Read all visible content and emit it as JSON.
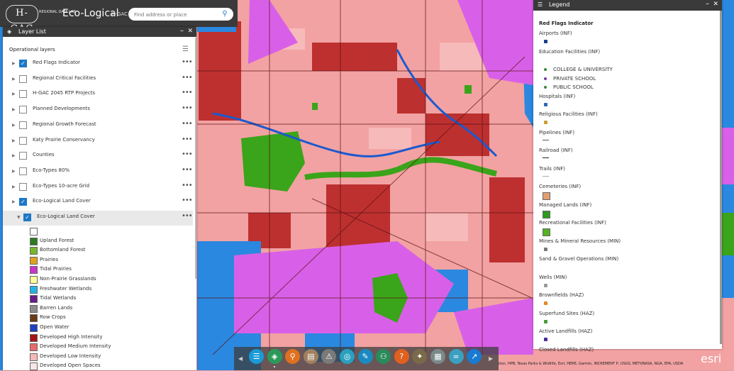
{
  "header": {
    "logo_text": "H-GAC",
    "logo_sub": "REGIONAL DATA LAB",
    "title": "Eco-Logical",
    "subtitle": "H-GAC",
    "search_placeholder": "Find address or place",
    "search_icon": "search-icon"
  },
  "layer_list": {
    "title": "Layer List",
    "section_label": "Operational layers",
    "layers": [
      {
        "label": "Red Flags Indicator",
        "checked": true
      },
      {
        "label": "Regional Critical Facilities",
        "checked": false
      },
      {
        "label": "H-GAC 2045 RTP Projects",
        "checked": false
      },
      {
        "label": "Planned Developments",
        "checked": false
      },
      {
        "label": "Regional Growth Forecast",
        "checked": false
      },
      {
        "label": "Katy Prairie Conservancy",
        "checked": false
      },
      {
        "label": "Counties",
        "checked": false
      },
      {
        "label": "Eco-Types 80%",
        "checked": false
      },
      {
        "label": "Eco-Types 10-acre Grid",
        "checked": false
      },
      {
        "label": "Eco-Logical Land Cover",
        "checked": true
      }
    ],
    "sublayer": {
      "label": "Eco-Logical Land Cover",
      "checked": true
    },
    "land_cover": [
      {
        "label": "",
        "color": "#ffffff"
      },
      {
        "label": "Upland Forest",
        "color": "#2d7a1f"
      },
      {
        "label": "Bottomland Forest",
        "color": "#76b82a"
      },
      {
        "label": "Prairies",
        "color": "#e0a020"
      },
      {
        "label": "Tidal Prairies",
        "color": "#cc33cc"
      },
      {
        "label": "Non-Prairie Grasslands",
        "color": "#ffff99"
      },
      {
        "label": "Freshwater Wetlands",
        "color": "#22b5e8"
      },
      {
        "label": "Tidal Wetlands",
        "color": "#6a1a8a"
      },
      {
        "label": "Barren Lands",
        "color": "#8c8c8c"
      },
      {
        "label": "Row Crops",
        "color": "#6b3a14"
      },
      {
        "label": "Open Water",
        "color": "#1f3fc4"
      },
      {
        "label": "Developed High Intensity",
        "color": "#a81414"
      },
      {
        "label": "Developed Medium Intensity",
        "color": "#e86a6a"
      },
      {
        "label": "Developed Low Intensity",
        "color": "#f6b8b8"
      },
      {
        "label": "Developed Open Spaces",
        "color": "#f6e6e6"
      }
    ],
    "more_glyph": "•••"
  },
  "legend": {
    "title": "Legend",
    "layer_title": "Red Flags Indicator",
    "items": [
      {
        "label": "Airports (INF)",
        "symbol": "airport-symbol",
        "color": "#1c3e8a"
      },
      {
        "label": "Education Facilities (INF)",
        "symbol": "none",
        "color": ""
      },
      {
        "label": "COLLEGE & UNIVERSITY",
        "symbol": "dot",
        "color": "#3a8a3a"
      },
      {
        "label": "PRIVATE SCHOOL",
        "symbol": "dot",
        "color": "#7a3a9a"
      },
      {
        "label": "PUBLIC SCHOOL",
        "symbol": "dot",
        "color": "#3a8a3a"
      },
      {
        "label": "Hospitals (INF)",
        "symbol": "hospital-symbol",
        "color": "#2c6ab0"
      },
      {
        "label": "Religious Facilities (INF)",
        "symbol": "diamond",
        "color": "#c8a030"
      },
      {
        "label": "Pipelines (INF)",
        "symbol": "line",
        "color": "#555555"
      },
      {
        "label": "Railroad (INF)",
        "symbol": "line",
        "color": "#222222"
      },
      {
        "label": "Trails (INF)",
        "symbol": "line",
        "color": "#aaaaaa"
      },
      {
        "label": "Cemeteries (INF)",
        "symbol": "square",
        "color": "#e0a070"
      },
      {
        "label": "Managed Lands (INF)",
        "symbol": "square",
        "color": "#2f9a1f"
      },
      {
        "label": "Recreational Facilities (INF)",
        "symbol": "square",
        "color": "#5ab020"
      },
      {
        "label": "Mines & Mineral Resources (MIN)",
        "symbol": "star",
        "color": "#777777"
      },
      {
        "label": "Sand & Gravel Operations (MIN)",
        "symbol": "none",
        "color": ""
      },
      {
        "label": "Wells (MIN)",
        "symbol": "dot",
        "color": "#999999"
      },
      {
        "label": "Brownfields (HAZ)",
        "symbol": "dot",
        "color": "#e08a20"
      },
      {
        "label": "Superfund Sites (HAZ)",
        "symbol": "dot",
        "color": "#4a9a3a"
      },
      {
        "label": "Active Landfills (HAZ)",
        "symbol": "square-small",
        "color": "#4a2a9a"
      },
      {
        "label": "Closed Landfills (HAZ)",
        "symbol": "none",
        "color": ""
      }
    ]
  },
  "toolbar": {
    "tools": [
      {
        "name": "list-tool",
        "color": "#1a9ad6",
        "glyph": "☰"
      },
      {
        "name": "layers-tool",
        "color": "#2a9a5a",
        "glyph": "◈"
      },
      {
        "name": "location-tool",
        "color": "#e07020",
        "glyph": "⚲"
      },
      {
        "name": "basemap-tool",
        "color": "#a08060",
        "glyph": "▤"
      },
      {
        "name": "warning-tool",
        "color": "#7a7a7a",
        "glyph": "⚠"
      },
      {
        "name": "measure-tool",
        "color": "#2aa0c0",
        "glyph": "◎"
      },
      {
        "name": "draw-tool",
        "color": "#1a8ac0",
        "glyph": "✎"
      },
      {
        "name": "people-tool",
        "color": "#2a8a5a",
        "glyph": "⚇"
      },
      {
        "name": "help-tool",
        "color": "#e06020",
        "glyph": "?"
      },
      {
        "name": "education-tool",
        "color": "#7a6a4a",
        "glyph": "✦"
      },
      {
        "name": "table-tool",
        "color": "#7a8a8a",
        "glyph": "▦"
      },
      {
        "name": "link-tool",
        "color": "#3aa0c0",
        "glyph": "∞"
      },
      {
        "name": "share-tool",
        "color": "#1a7ad0",
        "glyph": "↗"
      }
    ]
  },
  "attribution": "ston, HPB, Texas Parks & Wildlife, Esri, HERE, Garmin, INCREMENT P, USGS, METI/NASA, NGA, EPA, USDA",
  "esri_logo": "esri",
  "colors": {
    "dark_panel": "#3a3a3a",
    "urban_pink": "#f2a2a2",
    "dense_red": "#b82424",
    "wetland_blue": "#2a88e0",
    "tidal_magenta": "#d860e8",
    "forest_green": "#3aa41a"
  }
}
